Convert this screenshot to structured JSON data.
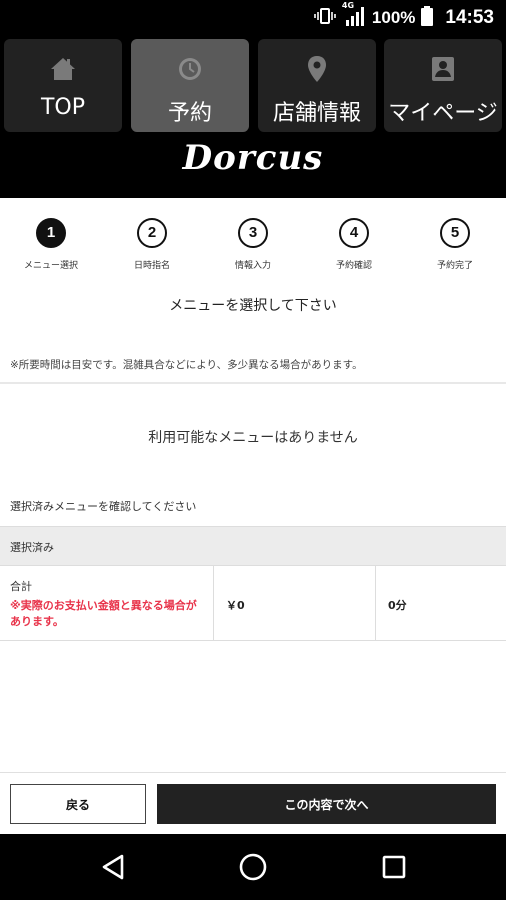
{
  "status_bar": {
    "network": "4G",
    "battery": "100%",
    "time": "14:53"
  },
  "nav": {
    "tabs": [
      {
        "label": "TOP",
        "icon": "home-icon",
        "active": false
      },
      {
        "label": "予約",
        "icon": "clock-icon",
        "active": true
      },
      {
        "label": "店舗情報",
        "icon": "location-pin-icon",
        "active": false
      },
      {
        "label": "マイページ",
        "icon": "person-icon",
        "active": false
      }
    ]
  },
  "logo": "Dorcus",
  "steps": [
    {
      "num": "1",
      "label": "メニュー選択",
      "active": true
    },
    {
      "num": "2",
      "label": "日時指名",
      "active": false
    },
    {
      "num": "3",
      "label": "情報入力",
      "active": false
    },
    {
      "num": "4",
      "label": "予約確認",
      "active": false
    },
    {
      "num": "5",
      "label": "予約完了",
      "active": false
    }
  ],
  "instruction": "メニューを選択して下さい",
  "note": "※所要時間は目安です。混雑具合などにより、多少異なる場合があります。",
  "empty_message": "利用可能なメニューはありません",
  "confirm_text": "選択済みメニューを確認してください",
  "selected": {
    "header": "選択済み",
    "total_label": "合計",
    "warning": "※実際のお支払い金額と異なる場合があります。",
    "price": "￥0",
    "duration": "0分"
  },
  "buttons": {
    "back": "戻る",
    "next": "この内容で次へ"
  },
  "colors": {
    "header_bg": "#000000",
    "active_tab": "#5a5a5a",
    "warning": "#e8334a",
    "next_button": "#222222"
  }
}
